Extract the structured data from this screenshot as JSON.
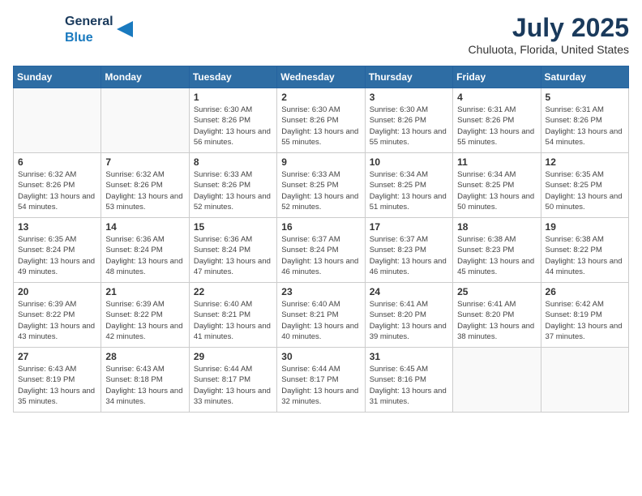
{
  "header": {
    "logo_line1": "General",
    "logo_line2": "Blue",
    "title": "July 2025",
    "subtitle": "Chuluota, Florida, United States"
  },
  "weekdays": [
    "Sunday",
    "Monday",
    "Tuesday",
    "Wednesday",
    "Thursday",
    "Friday",
    "Saturday"
  ],
  "weeks": [
    [
      {
        "day": "",
        "info": ""
      },
      {
        "day": "",
        "info": ""
      },
      {
        "day": "1",
        "info": "Sunrise: 6:30 AM\nSunset: 8:26 PM\nDaylight: 13 hours and 56 minutes."
      },
      {
        "day": "2",
        "info": "Sunrise: 6:30 AM\nSunset: 8:26 PM\nDaylight: 13 hours and 55 minutes."
      },
      {
        "day": "3",
        "info": "Sunrise: 6:30 AM\nSunset: 8:26 PM\nDaylight: 13 hours and 55 minutes."
      },
      {
        "day": "4",
        "info": "Sunrise: 6:31 AM\nSunset: 8:26 PM\nDaylight: 13 hours and 55 minutes."
      },
      {
        "day": "5",
        "info": "Sunrise: 6:31 AM\nSunset: 8:26 PM\nDaylight: 13 hours and 54 minutes."
      }
    ],
    [
      {
        "day": "6",
        "info": "Sunrise: 6:32 AM\nSunset: 8:26 PM\nDaylight: 13 hours and 54 minutes."
      },
      {
        "day": "7",
        "info": "Sunrise: 6:32 AM\nSunset: 8:26 PM\nDaylight: 13 hours and 53 minutes."
      },
      {
        "day": "8",
        "info": "Sunrise: 6:33 AM\nSunset: 8:26 PM\nDaylight: 13 hours and 52 minutes."
      },
      {
        "day": "9",
        "info": "Sunrise: 6:33 AM\nSunset: 8:25 PM\nDaylight: 13 hours and 52 minutes."
      },
      {
        "day": "10",
        "info": "Sunrise: 6:34 AM\nSunset: 8:25 PM\nDaylight: 13 hours and 51 minutes."
      },
      {
        "day": "11",
        "info": "Sunrise: 6:34 AM\nSunset: 8:25 PM\nDaylight: 13 hours and 50 minutes."
      },
      {
        "day": "12",
        "info": "Sunrise: 6:35 AM\nSunset: 8:25 PM\nDaylight: 13 hours and 50 minutes."
      }
    ],
    [
      {
        "day": "13",
        "info": "Sunrise: 6:35 AM\nSunset: 8:24 PM\nDaylight: 13 hours and 49 minutes."
      },
      {
        "day": "14",
        "info": "Sunrise: 6:36 AM\nSunset: 8:24 PM\nDaylight: 13 hours and 48 minutes."
      },
      {
        "day": "15",
        "info": "Sunrise: 6:36 AM\nSunset: 8:24 PM\nDaylight: 13 hours and 47 minutes."
      },
      {
        "day": "16",
        "info": "Sunrise: 6:37 AM\nSunset: 8:24 PM\nDaylight: 13 hours and 46 minutes."
      },
      {
        "day": "17",
        "info": "Sunrise: 6:37 AM\nSunset: 8:23 PM\nDaylight: 13 hours and 46 minutes."
      },
      {
        "day": "18",
        "info": "Sunrise: 6:38 AM\nSunset: 8:23 PM\nDaylight: 13 hours and 45 minutes."
      },
      {
        "day": "19",
        "info": "Sunrise: 6:38 AM\nSunset: 8:22 PM\nDaylight: 13 hours and 44 minutes."
      }
    ],
    [
      {
        "day": "20",
        "info": "Sunrise: 6:39 AM\nSunset: 8:22 PM\nDaylight: 13 hours and 43 minutes."
      },
      {
        "day": "21",
        "info": "Sunrise: 6:39 AM\nSunset: 8:22 PM\nDaylight: 13 hours and 42 minutes."
      },
      {
        "day": "22",
        "info": "Sunrise: 6:40 AM\nSunset: 8:21 PM\nDaylight: 13 hours and 41 minutes."
      },
      {
        "day": "23",
        "info": "Sunrise: 6:40 AM\nSunset: 8:21 PM\nDaylight: 13 hours and 40 minutes."
      },
      {
        "day": "24",
        "info": "Sunrise: 6:41 AM\nSunset: 8:20 PM\nDaylight: 13 hours and 39 minutes."
      },
      {
        "day": "25",
        "info": "Sunrise: 6:41 AM\nSunset: 8:20 PM\nDaylight: 13 hours and 38 minutes."
      },
      {
        "day": "26",
        "info": "Sunrise: 6:42 AM\nSunset: 8:19 PM\nDaylight: 13 hours and 37 minutes."
      }
    ],
    [
      {
        "day": "27",
        "info": "Sunrise: 6:43 AM\nSunset: 8:19 PM\nDaylight: 13 hours and 35 minutes."
      },
      {
        "day": "28",
        "info": "Sunrise: 6:43 AM\nSunset: 8:18 PM\nDaylight: 13 hours and 34 minutes."
      },
      {
        "day": "29",
        "info": "Sunrise: 6:44 AM\nSunset: 8:17 PM\nDaylight: 13 hours and 33 minutes."
      },
      {
        "day": "30",
        "info": "Sunrise: 6:44 AM\nSunset: 8:17 PM\nDaylight: 13 hours and 32 minutes."
      },
      {
        "day": "31",
        "info": "Sunrise: 6:45 AM\nSunset: 8:16 PM\nDaylight: 13 hours and 31 minutes."
      },
      {
        "day": "",
        "info": ""
      },
      {
        "day": "",
        "info": ""
      }
    ]
  ]
}
